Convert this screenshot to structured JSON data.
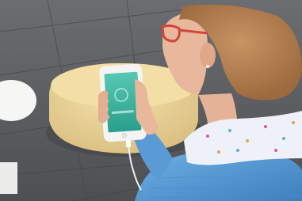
{
  "scene": {
    "phone_screen_text": ""
  },
  "colors": {
    "floor": "#58595b",
    "floor_grout": "#4a4b4e",
    "ottoman": "#efd79a",
    "ottoman_shadow": "#cdb479",
    "table_white": "#f6f6f4",
    "sweater": "#5f9fd8",
    "sweater_dark": "#3f7fbd",
    "scarf": "#eef2f8",
    "skin": "#e8b79c",
    "hair": "#b9804f",
    "glasses": "#d0463e",
    "phone_screen": "#37b49d",
    "phone_body": "#f4f4f4",
    "cable": "#f0f0f0"
  }
}
